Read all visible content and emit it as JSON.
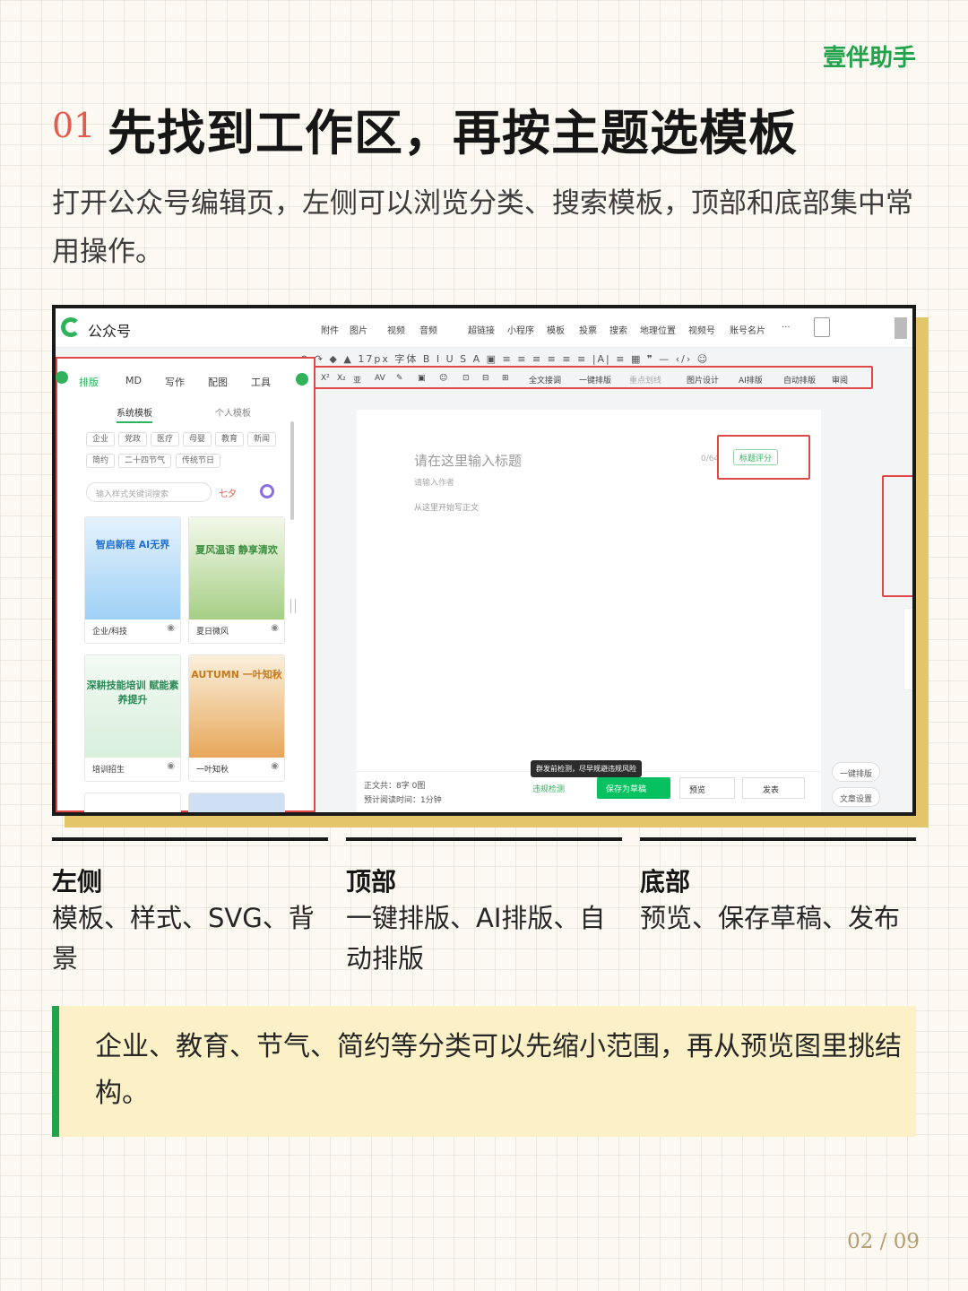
{
  "brand": "壹伴助手",
  "header": {
    "number": "01",
    "title": "先找到工作区，再按主题选模板"
  },
  "intro": "打开公众号编辑页，左侧可以浏览分类、搜索模板，顶部和底部集中常用操作。",
  "screenshot": {
    "app_name": "公众号",
    "top_nav": [
      "附件",
      "图片",
      "视频",
      "音频",
      "超链接",
      "小程序",
      "模板",
      "投票",
      "搜索",
      "地理位置",
      "视频号",
      "账号名片",
      "···"
    ],
    "format_row": "↶ ↷ ◆ ▲ 17px 字体 B I U S A ▣ ≡ ≡ ≡ ≡ ≡ ≡ |A| ≡ ▦ ❞ — ‹/› ☺",
    "toolbar2": [
      "X²",
      "X₂",
      "亚",
      "AV",
      "✎",
      "▣",
      "☺",
      "⊡",
      "⊟",
      "⊞",
      "全文接调",
      "一键排版",
      "重点划线",
      "图片设计",
      "AI排版",
      "自动排版",
      "审阅"
    ],
    "panel": {
      "tabs": [
        "排版",
        "MD",
        "写作",
        "配图",
        "工具"
      ],
      "subtabs": [
        "系统模板",
        "个人模板"
      ],
      "chips": [
        "企业",
        "党政",
        "医疗",
        "母婴",
        "教育",
        "新闻",
        "简约",
        "二十四节气",
        "传统节日"
      ],
      "search_placeholder": "输入样式关键词搜索",
      "hot": "七夕",
      "cards": [
        {
          "caption": "企业/科技",
          "title": "智启新程 AI无界",
          "bg": "#cfe7fb",
          "fg": "#1d6fd6"
        },
        {
          "caption": "夏日微风",
          "title": "夏风温语 静享清欢",
          "bg": "#e3f1d7",
          "fg": "#3e8e41"
        },
        {
          "caption": "培训招生",
          "title": "深耕技能培训 赋能素养提升",
          "bg": "#eaf6ec",
          "fg": "#2a8a55"
        },
        {
          "caption": "一叶知秋",
          "title": "AUTUMN 一叶知秋",
          "bg": "#f8e5c4",
          "fg": "#c47a1d"
        }
      ]
    },
    "editor": {
      "title_placeholder": "请在这里输入标题",
      "counter": "0/64",
      "author_placeholder": "请输入作者",
      "body_placeholder": "从这里开始写正文",
      "score_button": "标题评分"
    },
    "bottom": {
      "word_count": "正文共：8字 0图",
      "read_time": "预计阅读时间：1分钟",
      "tooltip": "群发前检测，尽早规避违规风险",
      "check": "违规检测",
      "save": "保存为草稿",
      "preview": "预览",
      "publish": "发表"
    },
    "side_buttons": [
      "一键排版",
      "文章设置"
    ]
  },
  "labels": [
    {
      "title": "左侧",
      "body": "模板、样式、SVG、背景"
    },
    {
      "title": "顶部",
      "body": "一键排版、AI排版、自动排版"
    },
    {
      "title": "底部",
      "body": "预览、保存草稿、发布"
    }
  ],
  "tip": "企业、教育、节气、简约等分类可以先缩小范围，再从预览图里挑结构。",
  "pager": "02 / 09",
  "colors": {
    "brand_green": "#22a24a",
    "accent_red": "#e25b4d",
    "highlight_yellow": "#e4c66a",
    "tip_bg": "#fcf1c6"
  }
}
